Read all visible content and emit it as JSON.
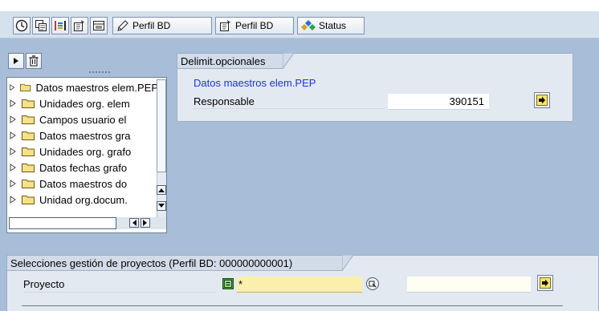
{
  "toolbar": {
    "buttons": [
      {
        "name": "execute",
        "icon": "clock-execute-icon"
      },
      {
        "name": "copy",
        "icon": "copy-icon"
      },
      {
        "name": "layout",
        "icon": "color-bars-icon"
      },
      {
        "name": "get-variant",
        "icon": "variant-icon"
      },
      {
        "name": "print",
        "icon": "print-icon"
      }
    ],
    "edit_icon": "pencil-icon",
    "edit_label": "Perfil BD",
    "profile_label": "Perfil BD",
    "status_label": "Status"
  },
  "tree": {
    "items": [
      "Datos maestros elem.PEP",
      "Unidades org. elem",
      "Campos usuario el",
      "Datos maestros gra",
      "Unidades org. grafo",
      "Datos fechas grafo",
      "Datos maestros do",
      "Unidad org.docum."
    ]
  },
  "optional_limits": {
    "title": "Delimit.opcionales",
    "section_link": "Datos maestros elem.PEP",
    "field_label": "Responsable",
    "field_value": "390151"
  },
  "selections": {
    "title": "Selecciones gestión de proyectos (Perfil BD: 000000000001)",
    "field_label": "Proyecto",
    "field_value": "*"
  },
  "colors": {
    "background": "#a8bed8",
    "group_bg": "#e3e9f1",
    "link_blue": "#1f35d6",
    "input_yellow": "#fbefae"
  }
}
